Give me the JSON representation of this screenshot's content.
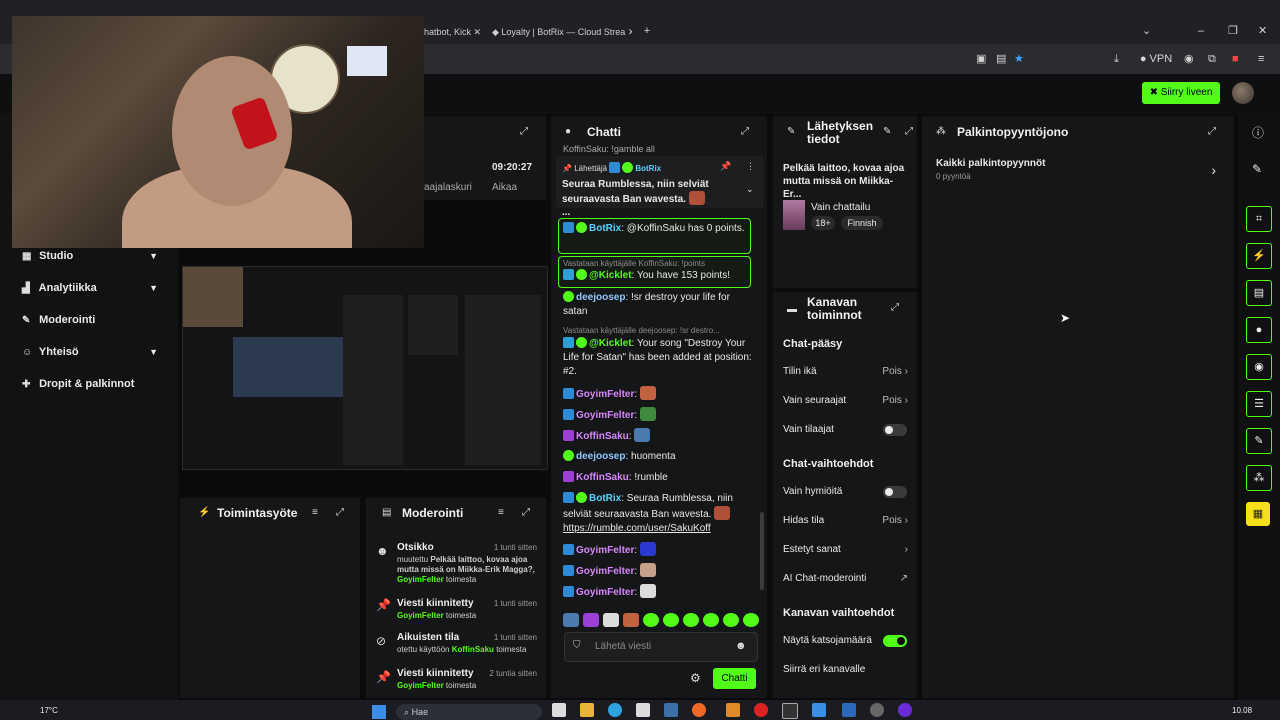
{
  "browser": {
    "tabs": [
      {
        "label": "hatbot, Kick"
      },
      {
        "label": "Loyalty | BotRix — Cloud Strea"
      }
    ],
    "new_tab": "+",
    "vpn_label": "VPN"
  },
  "kick": {
    "go_live_label": "Siirry liveen"
  },
  "sidebar": {
    "items": [
      {
        "label": "Studio",
        "icon": "studio-icon"
      },
      {
        "label": "Analytiikka",
        "icon": "chart-icon"
      },
      {
        "label": "Moderointi",
        "icon": "wrench-icon"
      },
      {
        "label": "Yhteisö",
        "icon": "people-icon"
      },
      {
        "label": "Dropit & palkinnot",
        "icon": "gift-icon"
      }
    ]
  },
  "stats": {
    "time": "09:20:27",
    "time_label": "Aikaa",
    "left_label": "aajalaskuri"
  },
  "chat": {
    "title": "Chatti",
    "pinned": {
      "by_label": "Lähettäjä",
      "user": "BotRix",
      "text": "Seuraa Rumblessa, niin selviät seuraavasta Ban wavesta.",
      "ellipsis": "..."
    },
    "top_cut": "KoffinSaku: !gamble all",
    "messages": [
      {
        "user": "BotRix",
        "text": "@KoffinSaku has 0 points."
      },
      {
        "reply": "Vastataan käyttäjälle KoffinSaku: !points",
        "user": "@Kicklet",
        "text": "You have 153 points!"
      },
      {
        "user": "deejoosep",
        "text": "!sr destroy your life for satan"
      },
      {
        "reply": "Vastataan käyttäjälle deejoosep: !sr destro...",
        "user": "@Kicklet",
        "text": "Your song \"Destroy Your Life for Satan\" has been added at position: #2."
      },
      {
        "user": "GoyimFelter",
        "text": ""
      },
      {
        "user": "GoyimFelter",
        "text": ""
      },
      {
        "user": "KoffinSaku",
        "text": ""
      },
      {
        "user": "deejoosep",
        "text": "huomenta"
      },
      {
        "user": "KoffinSaku",
        "text": "!rumble"
      },
      {
        "user": "BotRix",
        "text": "Seuraa Rumblessa, niin selviät seuraavasta Ban wavesta.",
        "link": "https://rumble.com/user/SakuKoff"
      },
      {
        "user": "GoyimFelter",
        "text": ""
      },
      {
        "user": "GoyimFelter",
        "text": ""
      },
      {
        "user": "GoyimFelter",
        "text": ""
      }
    ],
    "input_placeholder": "Lähetä viesti",
    "send_label": "Chatti"
  },
  "stream_info": {
    "title": "Lähetyksen tiedot",
    "stream_title": "Pelkää laittoo, kovaa ajoa mutta missä on Miikka-Er...",
    "category": "Vain chattailu",
    "tags": [
      "18+",
      "Finnish"
    ]
  },
  "channel_actions": {
    "title": "Kanavan toiminnot",
    "sections": {
      "chat_access": "Chat-pääsy",
      "chat_options": "Chat-vaihtoehdot",
      "channel_options": "Kanavan vaihtoehdot"
    },
    "rows": {
      "account_age": {
        "label": "Tilin ikä",
        "value": "Pois"
      },
      "followers_only": {
        "label": "Vain seuraajat",
        "value": "Pois"
      },
      "subscribers_only": {
        "label": "Vain tilaajat"
      },
      "emotes_only": {
        "label": "Vain hymiöitä"
      },
      "slow_mode": {
        "label": "Hidas tila",
        "value": "Pois"
      },
      "banned_words": {
        "label": "Estetyt sanat"
      },
      "ai_moderation": {
        "label": "AI Chat-moderointi"
      },
      "viewer_count": {
        "label": "Näytä katsojamäärä"
      },
      "switch_channel": {
        "label": "Siirrä eri kanavalle"
      }
    },
    "toggles": {
      "subscribers_only": false,
      "emotes_only": false,
      "viewer_count": true
    }
  },
  "rewards": {
    "title": "Palkintopyyntöjono",
    "all_label": "Kaikki palkintopyynnöt",
    "count_label": "0 pyyntöä"
  },
  "activity": {
    "title": "Toimintasyöte"
  },
  "moderation": {
    "title": "Moderointi",
    "entries": [
      {
        "title": "Otsikko",
        "time": "1 tunti sitten",
        "prefix": "muutettu",
        "detail": "Pelkää laittoo, kovaa ajoa mutta missä on Miikka-Erik Magga?,",
        "user": "GoyimFelter",
        "suffix": "toimesta"
      },
      {
        "title": "Viesti kiinnitetty",
        "time": "1 tunti sitten",
        "user": "GoyimFelter",
        "suffix": "toimesta"
      },
      {
        "title": "Aikuisten tila",
        "time": "1 tunti sitten",
        "prefix": "otettu käyttöön",
        "user": "KoffinSaku",
        "suffix": "toimesta"
      },
      {
        "title": "Viesti kiinnitetty",
        "time": "2 tuntia sitten",
        "user": "GoyimFelter",
        "suffix": "toimesta"
      }
    ]
  },
  "taskbar": {
    "weather": "17°C",
    "search": "Hae",
    "clock": "10.08"
  },
  "colors": {
    "accent": "#53fc18",
    "botrix": "#5ad2ff",
    "goyim": "#d886ff",
    "koffin": "#d886ff",
    "deejoosep": "#8fc8ff",
    "kicklet": "#53fc18"
  }
}
